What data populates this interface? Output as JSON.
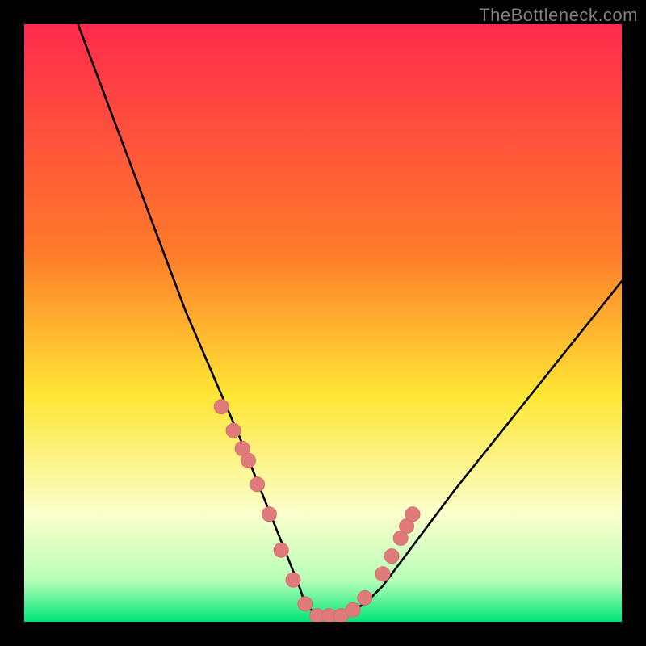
{
  "watermark": "TheBottleneck.com",
  "colors": {
    "frame": "#000000",
    "curve": "#000000",
    "dot_fill": "#e07b7b",
    "dot_stroke": "#d86e6e",
    "grad_top": "#ff2a4d",
    "grad_mid_orange": "#ff7a2a",
    "grad_mid_yellow": "#ffe633",
    "grad_pale": "#fbffcc",
    "grad_green_pale": "#b8ffb8",
    "grad_green": "#00e676"
  },
  "chart_data": {
    "type": "line",
    "title": "",
    "xlabel": "",
    "ylabel": "",
    "xlim": [
      0,
      100
    ],
    "ylim": [
      0,
      100
    ],
    "annotations": [],
    "series": [
      {
        "name": "bottleneck-curve",
        "x": [
          9,
          12,
          15,
          18,
          21,
          24,
          27,
          30,
          33,
          36,
          38,
          40,
          42,
          44,
          46,
          47,
          49,
          53,
          57,
          60,
          63,
          66,
          69,
          72,
          76,
          80,
          84,
          88,
          92,
          96,
          100
        ],
        "values": [
          100,
          92,
          84,
          76,
          68,
          60,
          52,
          45,
          38,
          31,
          26,
          21,
          16,
          11,
          6,
          3,
          1,
          1,
          3,
          6,
          10,
          14,
          18,
          22,
          27,
          32,
          37,
          42,
          47,
          52,
          57
        ]
      }
    ],
    "dots": {
      "name": "highlight-dots",
      "x": [
        33,
        35,
        36.5,
        37.5,
        39,
        41,
        43,
        45,
        47,
        49,
        51,
        53,
        55,
        57,
        60,
        61.5,
        63,
        64,
        65
      ],
      "values": [
        36,
        32,
        29,
        27,
        23,
        18,
        12,
        7,
        3,
        1,
        1,
        1,
        2,
        4,
        8,
        11,
        14,
        16,
        18
      ]
    }
  }
}
